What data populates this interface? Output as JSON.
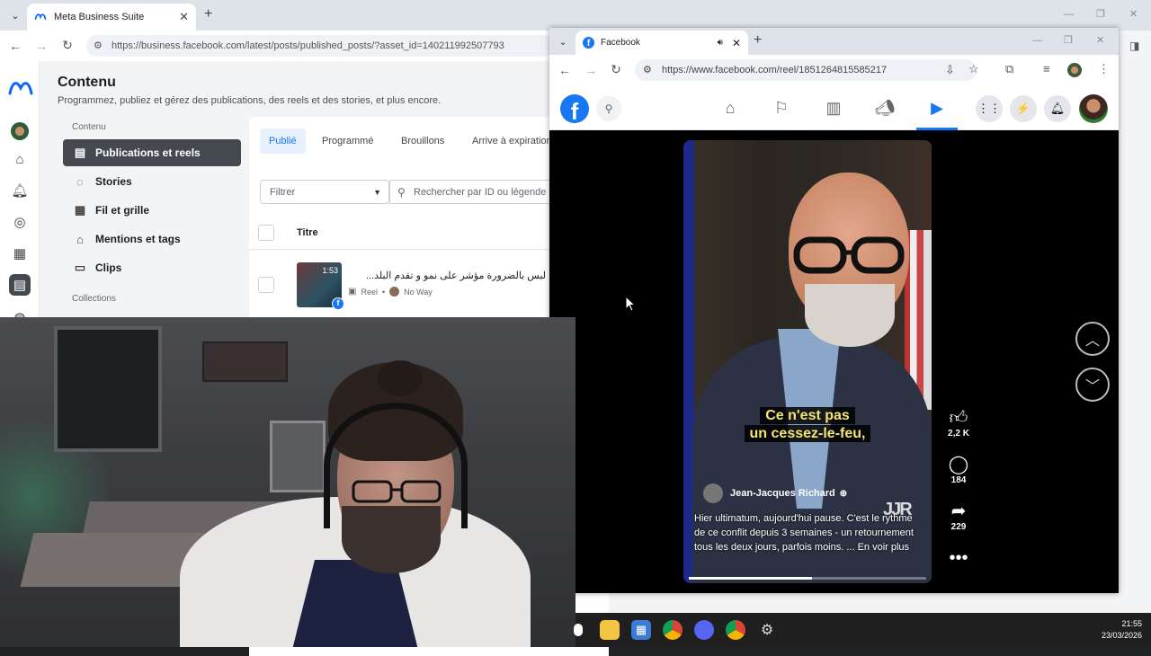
{
  "back_browser": {
    "tab_title": "Meta Business Suite",
    "url": "https://business.facebook.com/latest/posts/published_posts/?asset_id=140211992507793",
    "content": {
      "title": "Contenu",
      "subtitle": "Programmez, publiez et gérez des publications, des reels et des stories, et plus encore."
    },
    "subnav": {
      "section1": "Contenu",
      "items": [
        "Publications et reels",
        "Stories",
        "Fil et grille",
        "Mentions et tags",
        "Clips"
      ],
      "section2": "Collections"
    },
    "panel": {
      "tabs": [
        "Publié",
        "Programmé",
        "Brouillons",
        "Arrive à expiration"
      ],
      "filter_placeholder": "Filtrer",
      "search_placeholder": "Rechercher par ID ou légende",
      "column_title": "Titre",
      "row": {
        "duration": "1:53",
        "title": "لبس بالضرورة مؤشر على نمو و تقدم البلد...",
        "type": "Reel",
        "page": "No Way"
      }
    }
  },
  "front_browser": {
    "tab_title": "Facebook",
    "url": "https://www.facebook.com/reel/1851264815585217",
    "reel": {
      "caption_line1": "Ce n'est pas",
      "caption_line2": "un cessez-le-feu,",
      "author": "Jean-Jacques Richard",
      "logo": "JJR",
      "description": "Hier ultimatum, aujourd'hui pause. C'est le rythme de ce conflit depuis 3 semaines - un retournement tous les deux jours, parfois moins. ... En voir plus",
      "progress": 0.52,
      "likes": "2,2 K",
      "comments": "184",
      "shares": "229"
    }
  },
  "taskbar": {
    "time": "21:55",
    "date": "23/03/2026"
  },
  "colors": {
    "facebook_blue": "#1877f2",
    "caption_yellow": "#f5e56b",
    "active_nav": "#444950"
  }
}
